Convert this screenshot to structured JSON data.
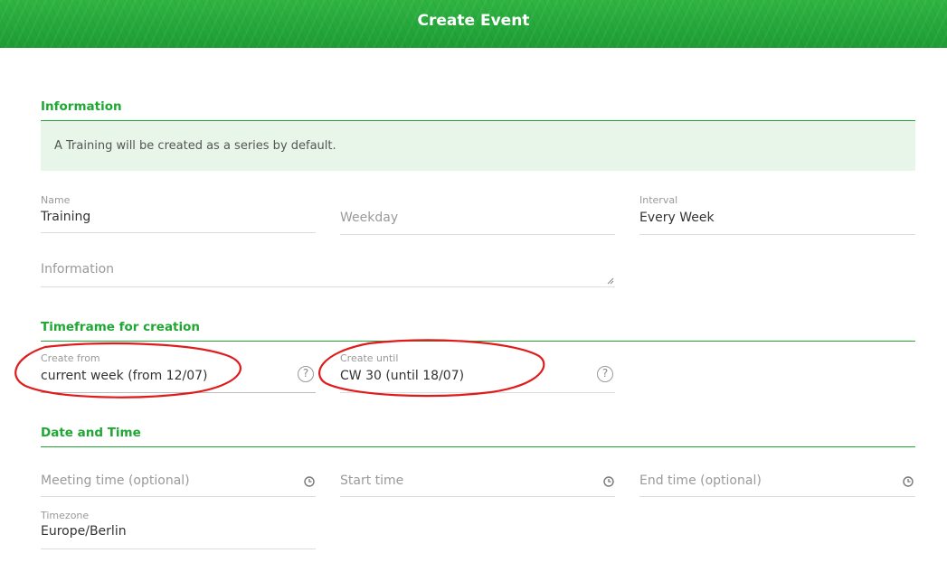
{
  "header": {
    "title": "Create Event"
  },
  "sections": {
    "information": "Information",
    "timeframe": "Timeframe for creation",
    "date_time": "Date and Time"
  },
  "info_notice": "A Training will be created as a series by default.",
  "fields": {
    "name": {
      "label": "Name",
      "value": "Training"
    },
    "weekday": {
      "placeholder": "Weekday"
    },
    "interval": {
      "label": "Interval",
      "value": "Every Week"
    },
    "information": {
      "placeholder": "Information"
    },
    "create_from": {
      "label": "Create from",
      "value": "current week (from 12/07)"
    },
    "create_until": {
      "label": "Create until",
      "value": "CW 30 (until 18/07)"
    },
    "meeting_time": {
      "placeholder": "Meeting time (optional)"
    },
    "start_time": {
      "placeholder": "Start time"
    },
    "end_time": {
      "placeholder": "End time (optional)"
    },
    "timezone": {
      "label": "Timezone",
      "value": "Europe/Berlin"
    }
  },
  "icons": {
    "help": "?",
    "help_icon_name": "question-circle-icon",
    "clock_icon_name": "clock-icon"
  },
  "colors": {
    "brand_green": "#1fa733",
    "info_bg": "#e8f6ea",
    "annotation_red": "#e01b1b"
  }
}
